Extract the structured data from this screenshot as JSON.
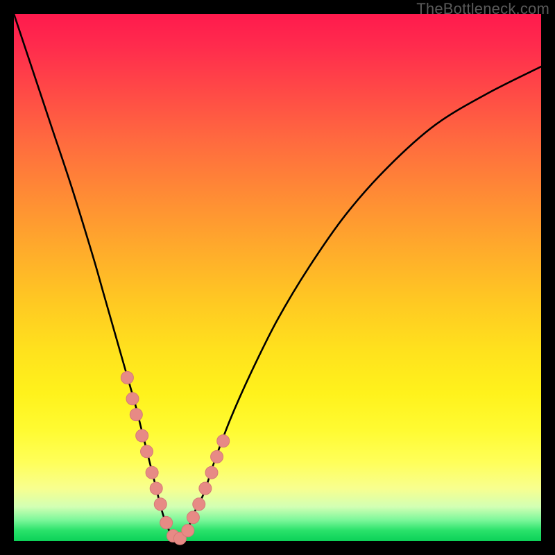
{
  "watermark": "TheBottleneck.com",
  "colors": {
    "curve": "#000000",
    "marker_fill": "#e78a85",
    "marker_stroke": "#d47a76",
    "gradient_top": "#ff1a4d",
    "gradient_bottom": "#0cd158",
    "frame": "#000000"
  },
  "chart_data": {
    "type": "line",
    "title": "",
    "xlabel": "",
    "ylabel": "",
    "xlim": [
      0,
      100
    ],
    "ylim": [
      0,
      100
    ],
    "grid": false,
    "legend": false,
    "series": [
      {
        "name": "bottleneck-curve",
        "x": [
          0,
          3,
          7,
          11,
          15,
          17,
          19,
          21,
          23,
          24,
          25,
          26,
          27,
          28,
          29,
          30,
          31,
          32,
          33,
          34,
          36,
          38,
          41,
          45,
          50,
          56,
          63,
          71,
          80,
          90,
          100
        ],
        "values": [
          100,
          91,
          79,
          67,
          54,
          47,
          40,
          33,
          26,
          22,
          18,
          14,
          10,
          6,
          3,
          1,
          0,
          0,
          2,
          5,
          9,
          15,
          23,
          32,
          42,
          52,
          62,
          71,
          79,
          85,
          90
        ]
      }
    ],
    "markers": {
      "name": "highlight-dots",
      "x": [
        21.5,
        22.5,
        23.2,
        24.3,
        25.2,
        26.2,
        27.0,
        27.8,
        28.9,
        30.2,
        31.5,
        33.0,
        34.0,
        35.1,
        36.3,
        37.5,
        38.5,
        39.7
      ],
      "values": [
        31,
        27,
        24,
        20,
        17,
        13,
        10,
        7,
        3.5,
        1,
        0.5,
        2,
        4.5,
        7,
        10,
        13,
        16,
        19
      ]
    }
  }
}
